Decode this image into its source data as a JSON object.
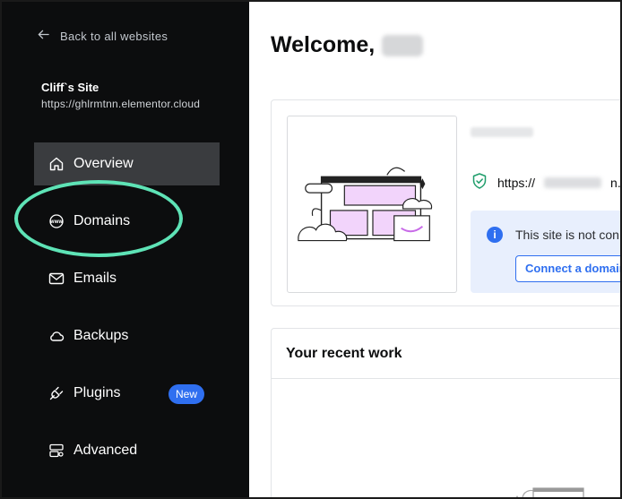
{
  "sidebar": {
    "back_label": "Back to all websites",
    "site_name": "Cliff`s Site",
    "site_url": "https://ghlrmtnn.elementor.cloud",
    "items": [
      {
        "label": "Overview",
        "icon": "home-icon",
        "active": true
      },
      {
        "label": "Domains",
        "icon": "www-globe-icon",
        "active": false
      },
      {
        "label": "Emails",
        "icon": "mail-icon",
        "active": false
      },
      {
        "label": "Backups",
        "icon": "cloud-icon",
        "active": false
      },
      {
        "label": "Plugins",
        "icon": "plug-icon",
        "active": false,
        "badge": "New"
      },
      {
        "label": "Advanced",
        "icon": "server-settings-icon",
        "active": false
      }
    ]
  },
  "main": {
    "welcome_prefix": "Welcome,",
    "site_card": {
      "url_prefix": "https://",
      "url_suffix": "n.elem",
      "notice_text": "This site is not con",
      "connect_button": "Connect a domain"
    },
    "recent_work_title": "Your recent work"
  },
  "colors": {
    "sidebar_bg": "#0c0d0e",
    "active_item_bg": "#3a3c3f",
    "highlight_ring": "#5ee3b6",
    "accent_blue": "#2f6ff0",
    "notice_bg": "#e8effd",
    "shield_green": "#1f9d6b"
  }
}
